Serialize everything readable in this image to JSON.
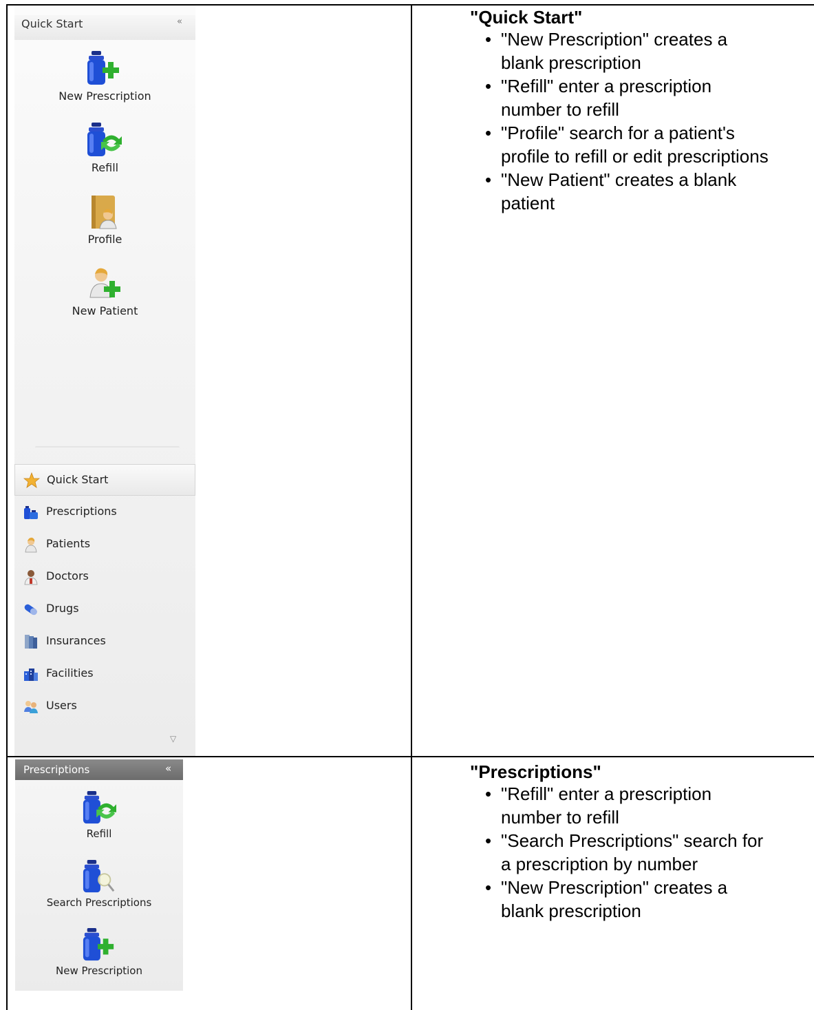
{
  "quick_start_panel": {
    "title": "Quick Start",
    "collapse_glyph": "«",
    "buttons": [
      {
        "label": "New Prescription",
        "icon": "new-prescription-icon"
      },
      {
        "label": "Refill",
        "icon": "refill-icon"
      },
      {
        "label": "Profile",
        "icon": "profile-icon"
      },
      {
        "label": "New Patient",
        "icon": "new-patient-icon"
      }
    ],
    "nav": [
      {
        "label": "Quick Start",
        "icon": "star-icon",
        "active": true
      },
      {
        "label": "Prescriptions",
        "icon": "prescriptions-icon"
      },
      {
        "label": "Patients",
        "icon": "patients-icon"
      },
      {
        "label": "Doctors",
        "icon": "doctors-icon"
      },
      {
        "label": "Drugs",
        "icon": "drugs-icon"
      },
      {
        "label": "Insurances",
        "icon": "insurances-icon"
      },
      {
        "label": "Facilities",
        "icon": "facilities-icon"
      },
      {
        "label": "Users",
        "icon": "users-icon"
      }
    ],
    "more_glyph": "▽"
  },
  "quick_start_desc": {
    "heading": "\"Quick Start\"",
    "items": [
      [
        "\"New Prescription\" creates a",
        "blank prescription"
      ],
      [
        "\"Refill\" enter a prescription",
        "number to refill"
      ],
      [
        "\"Profile\" search for a patient's",
        "profile to refill or edit prescriptions"
      ],
      [
        "\"New Patient\" creates a blank",
        "patient"
      ]
    ]
  },
  "prescriptions_panel": {
    "title": "Prescriptions",
    "collapse_glyph": "«",
    "buttons": [
      {
        "label": "Refill",
        "icon": "refill-icon"
      },
      {
        "label": "Search Prescriptions",
        "icon": "search-prescriptions-icon"
      },
      {
        "label": "New Prescription",
        "icon": "new-prescription-icon"
      }
    ]
  },
  "prescriptions_desc": {
    "heading": "\"Prescriptions\"",
    "items": [
      [
        "\"Refill\" enter a prescription",
        "number to refill"
      ],
      [
        "\"Search Prescriptions\" search for",
        "a prescription by number"
      ],
      [
        "\"New Prescription\" creates a",
        "blank prescription"
      ]
    ]
  },
  "colors": {
    "bottle_blue": "#1f4fd6",
    "bottle_cap": "#1a2f8a",
    "green_plus": "#2fb02f",
    "header_dark": "#7a7a7a"
  }
}
